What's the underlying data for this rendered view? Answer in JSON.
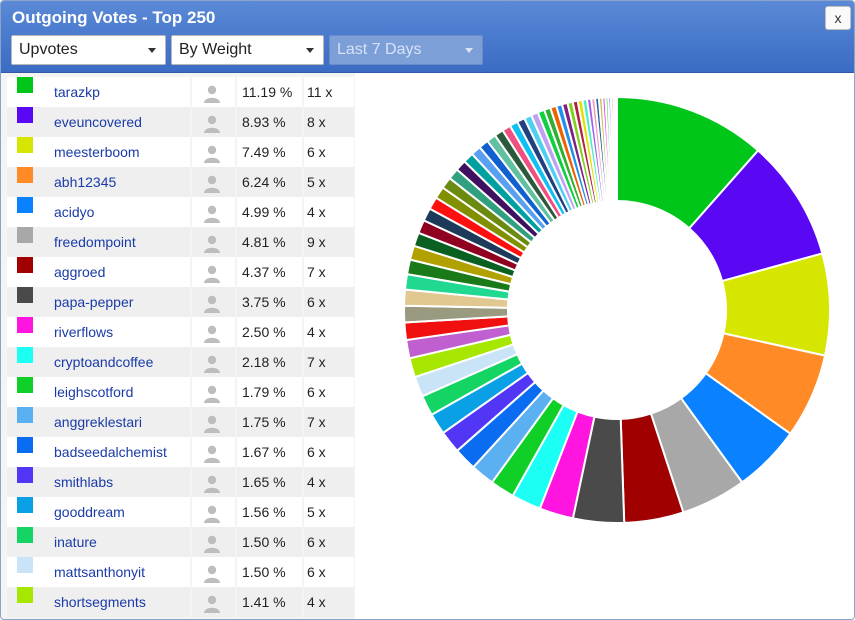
{
  "header": {
    "title": "Outgoing Votes - Top 250",
    "close_label": "x",
    "vote_type": "Upvotes",
    "sort_by": "By Weight",
    "period": "Last 7 Days"
  },
  "rows": [
    {
      "name": "tarazkp",
      "pct": "11.19 %",
      "count": "11 x",
      "color": "#00c61a"
    },
    {
      "name": "eveuncovered",
      "pct": "8.93 %",
      "count": "8 x",
      "color": "#5a08f4"
    },
    {
      "name": "meesterboom",
      "pct": "7.49 %",
      "count": "6 x",
      "color": "#d7e600"
    },
    {
      "name": "abh12345",
      "pct": "6.24 %",
      "count": "5 x",
      "color": "#ff8a26"
    },
    {
      "name": "acidyo",
      "pct": "4.99 %",
      "count": "4 x",
      "color": "#0a82ff"
    },
    {
      "name": "freedompoint",
      "pct": "4.81 %",
      "count": "9 x",
      "color": "#a8a8a8"
    },
    {
      "name": "aggroed",
      "pct": "4.37 %",
      "count": "7 x",
      "color": "#a00000"
    },
    {
      "name": "papa-pepper",
      "pct": "3.75 %",
      "count": "6 x",
      "color": "#4a4a4a"
    },
    {
      "name": "riverflows",
      "pct": "2.50 %",
      "count": "4 x",
      "color": "#ff14e0"
    },
    {
      "name": "cryptoandcoffee",
      "pct": "2.18 %",
      "count": "7 x",
      "color": "#1cfff5"
    },
    {
      "name": "leighscotford",
      "pct": "1.79 %",
      "count": "6 x",
      "color": "#10d028"
    },
    {
      "name": "anggreklestari",
      "pct": "1.75 %",
      "count": "7 x",
      "color": "#5bb0f2"
    },
    {
      "name": "badseedalchemist",
      "pct": "1.67 %",
      "count": "6 x",
      "color": "#0a6cf0"
    },
    {
      "name": "smithlabs",
      "pct": "1.65 %",
      "count": "4 x",
      "color": "#5236f5"
    },
    {
      "name": "gooddream",
      "pct": "1.56 %",
      "count": "5 x",
      "color": "#0aa0e6"
    },
    {
      "name": "inature",
      "pct": "1.50 %",
      "count": "6 x",
      "color": "#14d464"
    },
    {
      "name": "mattsanthonyit",
      "pct": "1.50 %",
      "count": "6 x",
      "color": "#c8e4f6"
    },
    {
      "name": "shortsegments",
      "pct": "1.41 %",
      "count": "4 x",
      "color": "#a6e600"
    }
  ],
  "chart_data": {
    "type": "pie",
    "values": [
      11.19,
      8.93,
      7.49,
      6.24,
      4.99,
      4.81,
      4.37,
      3.75,
      2.5,
      2.18,
      1.79,
      1.75,
      1.67,
      1.65,
      1.56,
      1.5,
      1.5,
      1.41,
      1.35,
      1.28,
      1.22,
      1.18,
      1.12,
      1.08,
      1.04,
      1.0,
      0.98,
      0.95,
      0.92,
      0.88,
      0.85,
      0.82,
      0.8,
      0.77,
      0.74,
      0.72,
      0.69,
      0.66,
      0.63,
      0.6,
      0.57,
      0.55,
      0.52,
      0.5,
      0.47,
      0.45,
      0.43,
      0.41,
      0.39,
      0.37,
      0.35,
      0.33,
      0.31,
      0.29,
      0.27,
      0.25,
      0.23,
      0.21,
      0.19,
      0.17,
      0.15,
      0.12
    ],
    "colors": [
      "#00c61a",
      "#5a08f4",
      "#d7e600",
      "#ff8a26",
      "#0a82ff",
      "#a8a8a8",
      "#a00000",
      "#4a4a4a",
      "#ff14e0",
      "#1cfff5",
      "#10d028",
      "#5bb0f2",
      "#0a6cf0",
      "#5236f5",
      "#0aa0e6",
      "#14d464",
      "#c8e4f6",
      "#a6e600",
      "#c060d0",
      "#f01010",
      "#9a9a80",
      "#e0c890",
      "#20d890",
      "#1a7a1a",
      "#b0a000",
      "#0a6020",
      "#900020",
      "#1e3a5a",
      "#ff1010",
      "#809000",
      "#6a8a10",
      "#30a080",
      "#401060",
      "#00a0a0",
      "#5aa0f0",
      "#1060d0",
      "#60c0a0",
      "#2a5a3a",
      "#f05080",
      "#10c0f0",
      "#204080",
      "#50d0f0",
      "#c0a0f0",
      "#10d040",
      "#30b030",
      "#f06000",
      "#2090f0",
      "#802080",
      "#80d020",
      "#b02040",
      "#e0e000",
      "#40f0c0",
      "#a060f0",
      "#f0a0c0",
      "#2060a0",
      "#c0c040",
      "#f040f0",
      "#60e060",
      "#8080ff",
      "#e08020",
      "#40a0c0",
      "#c02020"
    ]
  }
}
